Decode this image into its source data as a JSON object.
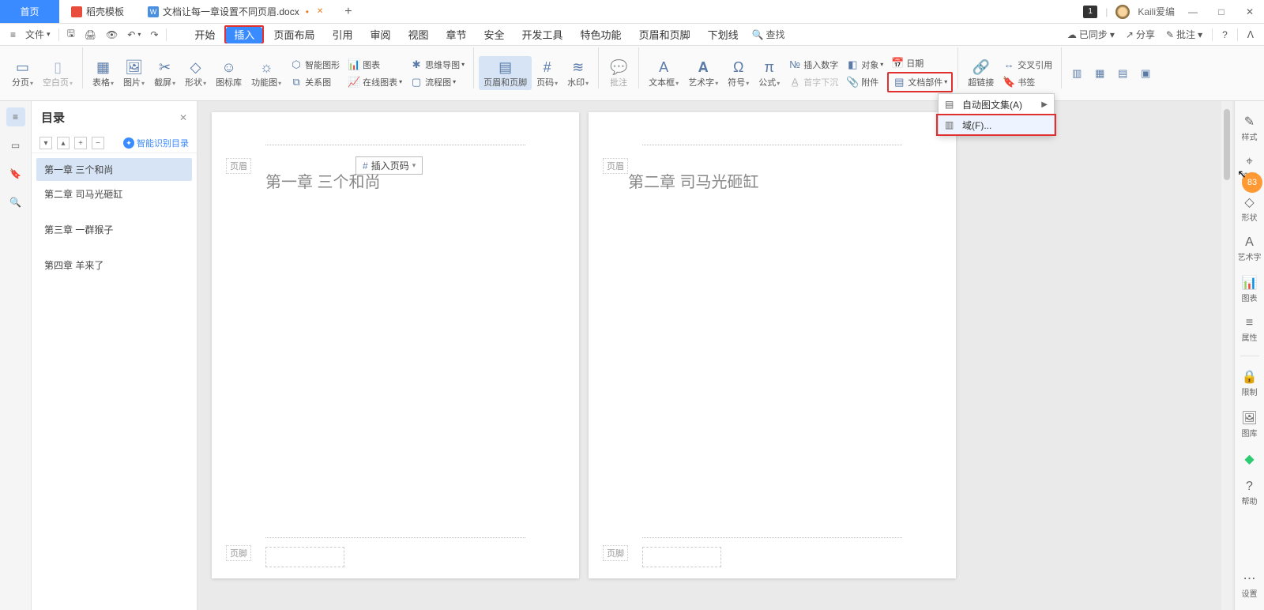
{
  "tabs": {
    "home": "首页",
    "shell": "稻壳模板",
    "doc": "文档让每一章设置不同页眉.docx",
    "add": "+"
  },
  "titlebar": {
    "badge": "1",
    "username": "Kaili爱编"
  },
  "qa": {
    "file": "文件",
    "arrow": "▾"
  },
  "menus": {
    "start": "开始",
    "insert": "插入",
    "layout": "页面布局",
    "ref": "引用",
    "review": "审阅",
    "view": "视图",
    "chapter": "章节",
    "safe": "安全",
    "dev": "开发工具",
    "feature": "特色功能",
    "hdrftr": "页眉和页脚",
    "underline": "下划线",
    "find": "查找"
  },
  "qaright": {
    "sync": "已同步",
    "share": "分享",
    "annotate": "批注"
  },
  "ribbon": {
    "page_break": "分页",
    "blank_page": "空白页",
    "table": "表格",
    "picture": "图片",
    "screenshot": "截屏",
    "shape": "形状",
    "icon_lib": "图标库",
    "feature_chart": "功能图",
    "smart_graphic": "智能图形",
    "chart": "图表",
    "relation": "关系图",
    "online_chart": "在线图表",
    "mindmap": "思维导图",
    "flowchart": "流程图",
    "header_footer": "页眉和页脚",
    "page_num": "页码",
    "watermark": "水印",
    "annotation": "批注",
    "textbox": "文本框",
    "wordart": "艺术字",
    "symbol": "符号",
    "formula": "公式",
    "insert_num": "插入数字",
    "dropcap": "首字下沉",
    "object": "对象",
    "attachment": "附件",
    "date": "日期",
    "doc_parts": "文档部件",
    "hyperlink": "超链接",
    "cross_ref": "交叉引用",
    "bookmark": "书签"
  },
  "dropdown": {
    "autotext": "自动图文集(A)",
    "field": "域(F)..."
  },
  "iconstrip": {},
  "toc": {
    "title": "目录",
    "smart": "智能识别目录",
    "items": [
      "第一章  三个和尚",
      "第二章  司马光砸缸",
      "第三章  一群猴子",
      "第四章  羊来了"
    ]
  },
  "doc": {
    "hdr": "页眉",
    "ftr": "页脚",
    "insert_hdr": "插入页码",
    "ch1": "第一章  三个和尚",
    "ch2": "第二章  司马光砸缸"
  },
  "rightpanel": {
    "style": "样式",
    "select": "选择",
    "shape": "形状",
    "wordart": "艺术字",
    "chart": "图表",
    "prop": "属性",
    "limit": "限制",
    "gallery": "图库",
    "help": "帮助",
    "settings": "设置"
  },
  "badge": "83"
}
